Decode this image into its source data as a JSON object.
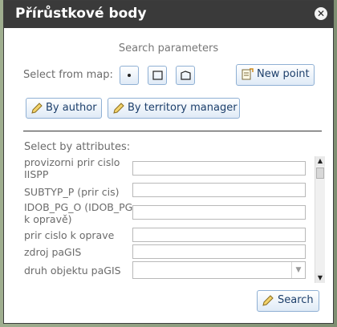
{
  "window": {
    "title": "Přírůstkové body"
  },
  "search": {
    "section_title": "Search parameters",
    "select_from_map_label": "Select from map:",
    "new_point_label": "New point",
    "by_author_label": "By author",
    "by_territory_manager_label": "By territory manager"
  },
  "attributes": {
    "heading": "Select by attributes:",
    "fields": [
      {
        "label": "provizorni prir cislo IISPP",
        "value": ""
      },
      {
        "label": "SUBTYP_P (prir cis)",
        "value": ""
      },
      {
        "label": "IDOB_PG_O (IDOB_PG k opravě)",
        "value": ""
      },
      {
        "label": "prir cislo k oprave",
        "value": ""
      },
      {
        "label": "zdroj paGIS",
        "value": ""
      },
      {
        "label": "druh objektu paGIS",
        "value": ""
      }
    ]
  },
  "footer": {
    "search_label": "Search"
  },
  "colors": {
    "titlebar": "#3a3a3a",
    "button_border": "#8fb0d4",
    "button_text": "#1d3f6b"
  }
}
